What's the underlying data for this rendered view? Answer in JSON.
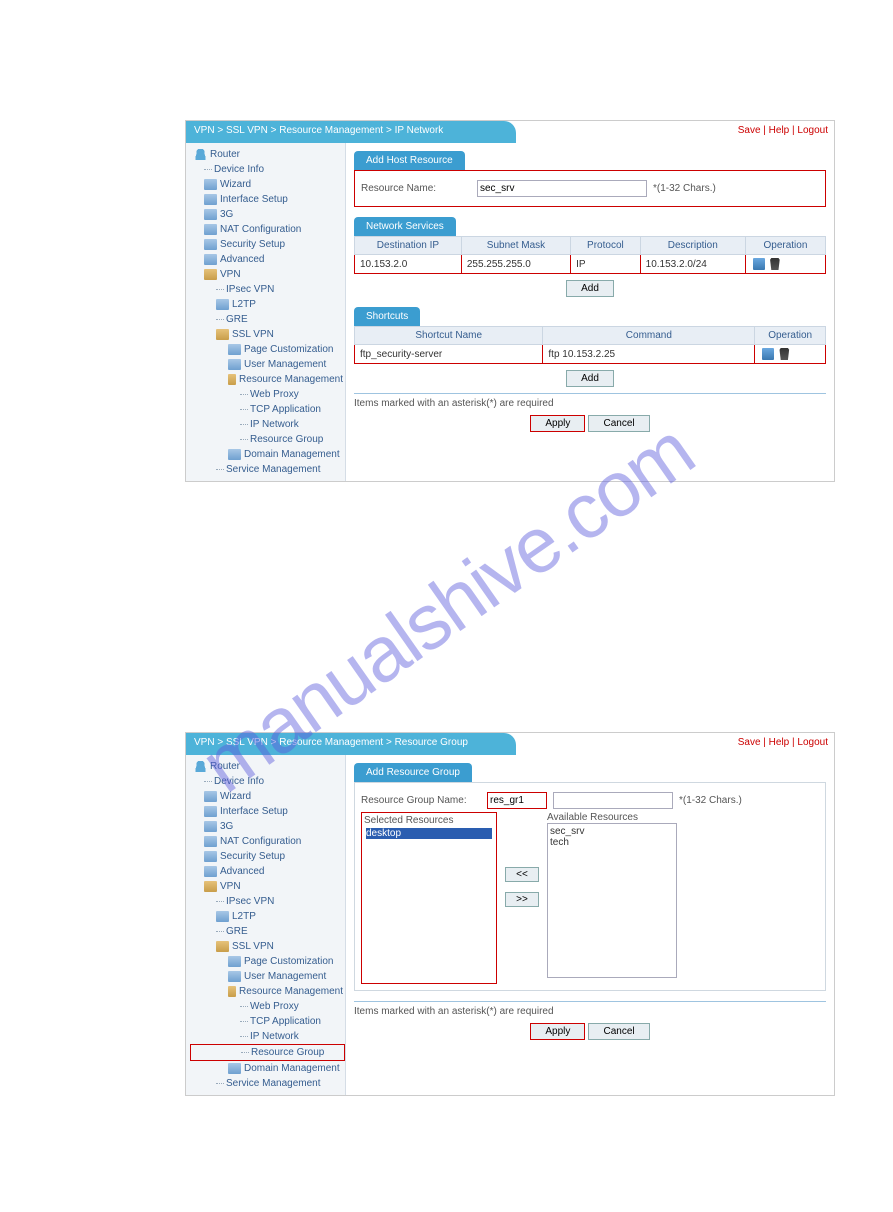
{
  "watermark": "manualshive.com",
  "top_links": {
    "save": "Save",
    "help": "Help",
    "logout": "Logout",
    "sep": " | "
  },
  "shot1": {
    "breadcrumb": "VPN > SSL VPN > Resource Management > IP Network",
    "router": "Router",
    "nav": {
      "device_info": "Device Info",
      "wizard": "Wizard",
      "iface": "Interface Setup",
      "g3": "3G",
      "nat": "NAT Configuration",
      "sec": "Security Setup",
      "adv": "Advanced",
      "vpn": "VPN",
      "ipsec": "IPsec VPN",
      "l2tp": "L2TP",
      "gre": "GRE",
      "sslvpn": "SSL VPN",
      "page": "Page Customization",
      "user": "User Management",
      "res": "Resource Management",
      "web": "Web Proxy",
      "tcp": "TCP Application",
      "ipnet": "IP Network",
      "rgroup": "Resource Group",
      "domain": "Domain Management",
      "svc": "Service Management"
    },
    "tabs": {
      "addhost": "Add Host Resource",
      "netsvc": "Network Services",
      "shortcuts": "Shortcuts"
    },
    "form": {
      "resname_lbl": "Resource Name:",
      "resname_val": "sec_srv",
      "hint": "*(1-32 Chars.)"
    },
    "net_hdr": {
      "dest": "Destination IP",
      "mask": "Subnet Mask",
      "proto": "Protocol",
      "desc": "Description",
      "op": "Operation"
    },
    "net_row": {
      "dest": "10.153.2.0",
      "mask": "255.255.255.0",
      "proto": "IP",
      "desc": "10.153.2.0/24"
    },
    "sc_hdr": {
      "name": "Shortcut Name",
      "cmd": "Command",
      "op": "Operation"
    },
    "sc_row": {
      "name": "ftp_security-server",
      "cmd": "ftp 10.153.2.25"
    },
    "btns": {
      "add": "Add",
      "apply": "Apply",
      "cancel": "Cancel"
    },
    "note": "Items marked with an asterisk(*) are required"
  },
  "shot2": {
    "breadcrumb": "VPN > SSL VPN > Resource Management > Resource Group",
    "router": "Router",
    "nav": {
      "device_info": "Device Info",
      "wizard": "Wizard",
      "iface": "Interface Setup",
      "g3": "3G",
      "nat": "NAT Configuration",
      "sec": "Security Setup",
      "adv": "Advanced",
      "vpn": "VPN",
      "ipsec": "IPsec VPN",
      "l2tp": "L2TP",
      "gre": "GRE",
      "sslvpn": "SSL VPN",
      "page": "Page Customization",
      "user": "User Management",
      "res": "Resource Management",
      "web": "Web Proxy",
      "tcp": "TCP Application",
      "ipnet": "IP Network",
      "rgroup": "Resource Group",
      "domain": "Domain Management",
      "svc": "Service Management"
    },
    "tab": "Add Resource Group",
    "form": {
      "grpname_lbl": "Resource Group Name:",
      "grpname_val": "res_gr1",
      "hint": "*(1-32 Chars.)",
      "sel_lbl": "Selected Resources",
      "avail_lbl": "Available Resources",
      "sel_items": [
        "desktop"
      ],
      "avail_items": [
        "sec_srv",
        "tech"
      ]
    },
    "btns": {
      "left": "<<",
      "right": ">>",
      "apply": "Apply",
      "cancel": "Cancel"
    },
    "note": "Items marked with an asterisk(*) are required"
  }
}
